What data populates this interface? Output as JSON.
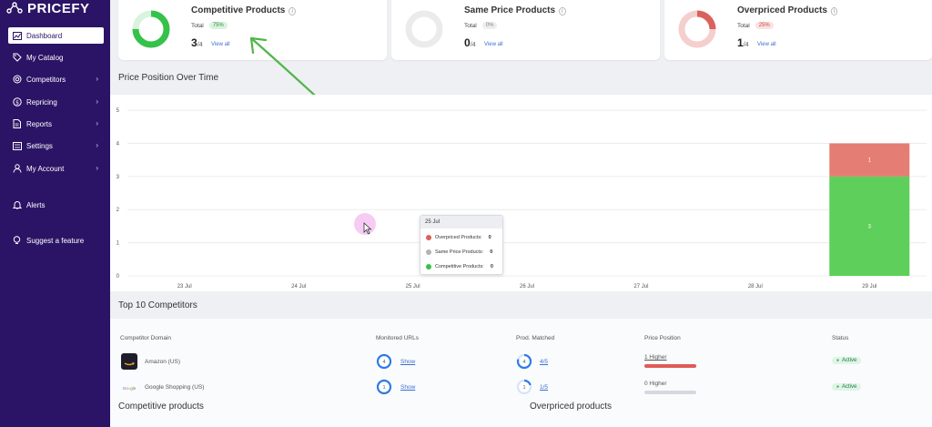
{
  "app": {
    "name": "PRICEFY"
  },
  "sidebar": {
    "items": [
      {
        "label": "Dashboard",
        "icon": "chart-icon",
        "active": true
      },
      {
        "label": "My Catalog",
        "icon": "tag-icon"
      },
      {
        "label": "Competitors",
        "icon": "target-icon",
        "chevron": "›"
      },
      {
        "label": "Repricing",
        "icon": "dollar-icon",
        "chevron": "›"
      },
      {
        "label": "Reports",
        "icon": "document-icon",
        "chevron": "›"
      },
      {
        "label": "Settings",
        "icon": "sliders-icon",
        "chevron": "›"
      },
      {
        "label": "My Account",
        "icon": "user-icon",
        "chevron": "›"
      },
      {
        "label": "Alerts",
        "icon": "bell-icon"
      },
      {
        "label": "Suggest a feature",
        "icon": "bulb-icon"
      }
    ]
  },
  "cards": [
    {
      "title": "Competitive Products",
      "total_label": "Total",
      "badge": "75%",
      "count": "3",
      "of": "/4",
      "view_all": "View all",
      "fraction": 0.75,
      "color": "#35c24a",
      "badge_bg": "#d9f3de",
      "badge_fg": "#2d8f3e",
      "track": "#d9f3de"
    },
    {
      "title": "Same Price Products",
      "total_label": "Total",
      "badge": "0%",
      "count": "0",
      "of": "/4",
      "view_all": "View all",
      "fraction": 0,
      "color": "#bbbbbb",
      "badge_bg": "#eeeeee",
      "badge_fg": "#888888",
      "track": "#ebebeb"
    },
    {
      "title": "Overpriced Products",
      "total_label": "Total",
      "badge": "25%",
      "count": "1",
      "of": "/4",
      "view_all": "View all",
      "fraction": 0.25,
      "color": "#d9625b",
      "badge_bg": "#fbe1e0",
      "badge_fg": "#c74a43",
      "track": "#f5cfcd"
    }
  ],
  "price_position": {
    "title": "Price Position Over Time"
  },
  "chart_data": {
    "type": "bar",
    "stacked": true,
    "categories": [
      "23 Jul",
      "24 Jul",
      "25 Jul",
      "26 Jul",
      "27 Jul",
      "28 Jul",
      "29 Jul"
    ],
    "series": [
      {
        "name": "Competitive Products",
        "color": "#5ecf5a",
        "values": [
          0,
          0,
          0,
          0,
          0,
          0,
          3
        ]
      },
      {
        "name": "Same Price Products",
        "color": "#b9b9b9",
        "values": [
          0,
          0,
          0,
          0,
          0,
          0,
          0
        ]
      },
      {
        "name": "Overpriced Products",
        "color": "#e47d74",
        "values": [
          0,
          0,
          0,
          0,
          0,
          0,
          1
        ]
      }
    ],
    "yticks": [
      "0",
      "1",
      "2",
      "3",
      "4",
      "5"
    ],
    "ylim": [
      0,
      5
    ]
  },
  "tooltip": {
    "date": "25 Jul",
    "rows": [
      {
        "label": "Overpriced Products:",
        "value": "0",
        "color": "#d9625b"
      },
      {
        "label": "Same Price Products:",
        "value": "0",
        "color": "#b3b3b3"
      },
      {
        "label": "Competitive Products:",
        "value": "0",
        "color": "#35c24a"
      }
    ]
  },
  "competitors": {
    "title": "Top 10 Competitors",
    "headers": [
      "Competitor Domain",
      "Monitored URLs",
      "Prod. Matched",
      "Price Position",
      "Status"
    ],
    "rows": [
      {
        "domain": "Amazon (US)",
        "urls": "4",
        "show": "Show",
        "matched": "4",
        "matched_frac": "4/5",
        "position": "1 Higher",
        "position_color": "#e05a57",
        "status": "Active",
        "match_ratio": 0.8
      },
      {
        "domain": "Google Shopping (US)",
        "urls": "1",
        "show": "Show",
        "matched": "1",
        "matched_frac": "1/5",
        "position": "0 Higher",
        "position_color": "#d5d8de",
        "status": "Active",
        "match_ratio": 0.2
      }
    ]
  },
  "bottom": {
    "left_title": "Competitive products",
    "right_title": "Overpriced products"
  }
}
